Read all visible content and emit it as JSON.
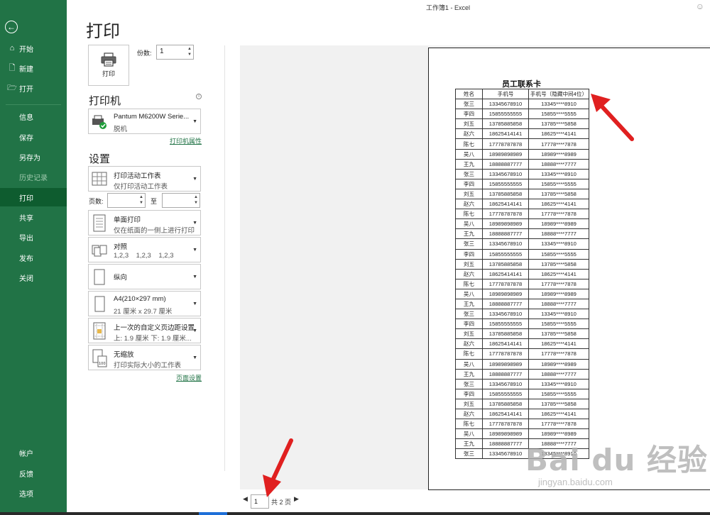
{
  "window": {
    "title": "工作簿1 - Excel"
  },
  "sidebar": {
    "back": "←",
    "top_items": [
      {
        "icon": "home-icon",
        "label": "开始"
      },
      {
        "icon": "new-doc-icon",
        "label": "新建"
      },
      {
        "icon": "open-folder-icon",
        "label": "打开"
      }
    ],
    "items": [
      {
        "label": "信息"
      },
      {
        "label": "保存"
      },
      {
        "label": "另存为"
      },
      {
        "label": "历史记录"
      },
      {
        "label": "打印"
      },
      {
        "label": "共享"
      },
      {
        "label": "导出"
      },
      {
        "label": "发布"
      },
      {
        "label": "关闭"
      }
    ],
    "bottom_items": [
      {
        "label": "帐户"
      },
      {
        "label": "反馈"
      },
      {
        "label": "选项"
      }
    ]
  },
  "page_title": "打印",
  "print_button": {
    "label": "打印"
  },
  "copies": {
    "label": "份数:",
    "value": "1"
  },
  "printer": {
    "section": "打印机",
    "name": "Pantum M6200W Serie...",
    "status": "脱机",
    "properties_link": "打印机属性"
  },
  "settings": {
    "section": "设置",
    "what": {
      "title": "打印活动工作表",
      "sub": "仅打印活动工作表"
    },
    "pages": {
      "label": "页数:",
      "to": "至",
      "from_value": "",
      "to_value": ""
    },
    "sides": {
      "title": "单面打印",
      "sub": "仅在纸面的一侧上进行打印"
    },
    "collate": {
      "title": "对照",
      "sub": "1,2,3    1,2,3    1,2,3"
    },
    "orientation": {
      "title": "纵向"
    },
    "paper": {
      "title": "A4(210×297 mm)",
      "sub": "21 厘米 x 29.7 厘米"
    },
    "margins": {
      "title": "上一次的自定义页边距设置",
      "sub": "上: 1.9 厘米 下: 1.9 厘米..."
    },
    "scaling": {
      "title": "无缩放",
      "sub": "打印实际大小的工作表"
    },
    "page_setup_link": "页面设置"
  },
  "preview": {
    "sheet_title": "员工联系卡",
    "headers": [
      "姓名",
      "手机号",
      "手机号（隐藏中间4位）"
    ],
    "rows": [
      [
        "张三",
        "13345678910",
        "13345****8910"
      ],
      [
        "李四",
        "15855555555",
        "15855****5555"
      ],
      [
        "刘五",
        "13785885858",
        "13785****5858"
      ],
      [
        "赵六",
        "18625414141",
        "18625****4141"
      ],
      [
        "陈七",
        "17778787878",
        "17778****7878"
      ],
      [
        "吴八",
        "18989898989",
        "18989****8989"
      ],
      [
        "王九",
        "18888887777",
        "18888****7777"
      ],
      [
        "张三",
        "13345678910",
        "13345****8910"
      ],
      [
        "李四",
        "15855555555",
        "15855****5555"
      ],
      [
        "刘五",
        "13785885858",
        "13785****5858"
      ],
      [
        "赵六",
        "18625414141",
        "18625****4141"
      ],
      [
        "陈七",
        "17778787878",
        "17778****7878"
      ],
      [
        "吴八",
        "18989898989",
        "18989****8989"
      ],
      [
        "王九",
        "18888887777",
        "18888****7777"
      ],
      [
        "张三",
        "13345678910",
        "13345****8910"
      ],
      [
        "李四",
        "15855555555",
        "15855****5555"
      ],
      [
        "刘五",
        "13785885858",
        "13785****5858"
      ],
      [
        "赵六",
        "18625414141",
        "18625****4141"
      ],
      [
        "陈七",
        "17778787878",
        "17778****7878"
      ],
      [
        "吴八",
        "18989898989",
        "18989****8989"
      ],
      [
        "王九",
        "18888887777",
        "18888****7777"
      ],
      [
        "张三",
        "13345678910",
        "13345****8910"
      ],
      [
        "李四",
        "15855555555",
        "15855****5555"
      ],
      [
        "刘五",
        "13785885858",
        "13785****5858"
      ],
      [
        "赵六",
        "18625414141",
        "18625****4141"
      ],
      [
        "陈七",
        "17778787878",
        "17778****7878"
      ],
      [
        "吴八",
        "18989898989",
        "18989****8989"
      ],
      [
        "王九",
        "18888887777",
        "18888****7777"
      ],
      [
        "张三",
        "13345678910",
        "13345****8910"
      ],
      [
        "李四",
        "15855555555",
        "15855****5555"
      ],
      [
        "刘五",
        "13785885858",
        "13785****5858"
      ],
      [
        "赵六",
        "18625414141",
        "18625****4141"
      ],
      [
        "陈七",
        "17778787878",
        "17778****7878"
      ],
      [
        "吴八",
        "18989898989",
        "18989****8989"
      ],
      [
        "王九",
        "18888887777",
        "18888****7777"
      ],
      [
        "张三",
        "13345678910",
        "13345****8910"
      ]
    ]
  },
  "page_nav": {
    "current": "1",
    "total_label": "共 2 页"
  },
  "watermark": {
    "main": "Bai du 经验",
    "sub": "jingyan.baidu.com"
  },
  "colors": {
    "accent": "#217346",
    "arrow": "#e02020"
  }
}
